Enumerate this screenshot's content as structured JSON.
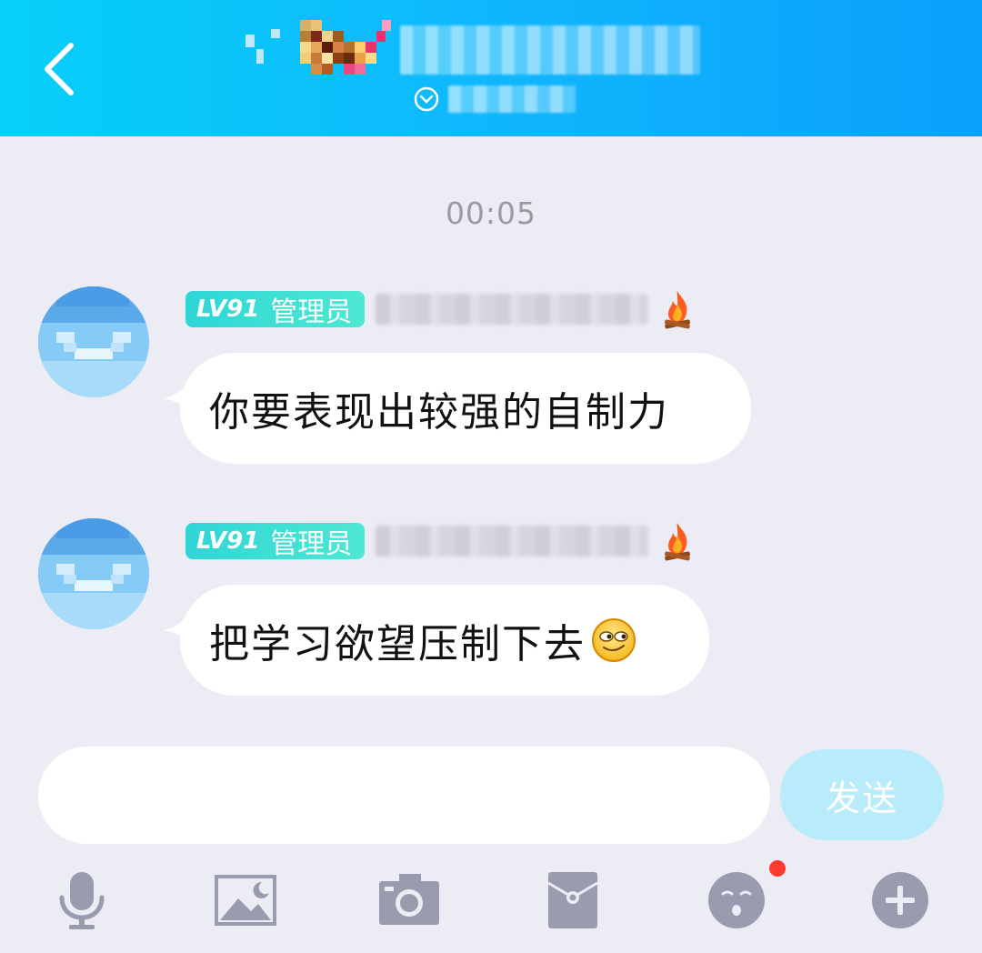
{
  "header": {
    "back_icon": "chevron-left-icon",
    "dropdown_icon": "chevron-down-circle-icon"
  },
  "chat": {
    "timestamp": "00:05",
    "messages": [
      {
        "level": "LV91",
        "role": "管理员",
        "badge_icon": "fire-icon",
        "text": "你要表现出较强的自制力"
      },
      {
        "level": "LV91",
        "role": "管理员",
        "badge_icon": "fire-icon",
        "text": "把学习欲望压制下去",
        "trailing_emoji": "smirk-emoji-icon"
      }
    ]
  },
  "composer": {
    "input_value": "",
    "send_label": "发送"
  },
  "toolbar": {
    "items": [
      "microphone-icon",
      "image-icon",
      "camera-icon",
      "red-packet-icon",
      "emoji-icon",
      "plus-icon"
    ]
  },
  "colors": {
    "header_start": "#06d0f9",
    "header_end": "#0a9ffb",
    "background": "#ececf5",
    "badge": "#2fd6d6",
    "send_button": "#b8ecfb",
    "toolbar_icon": "#9b9bb0",
    "notification_dot": "#ff3b30"
  }
}
